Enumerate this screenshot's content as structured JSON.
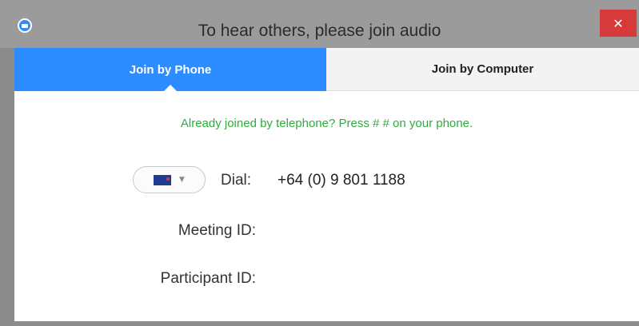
{
  "window": {
    "title": "To hear others, please join audio",
    "close_glyph": "✕"
  },
  "tabs": [
    {
      "label": "Join by Phone",
      "active": true
    },
    {
      "label": "Join by Computer",
      "active": false
    }
  ],
  "notice": "Already joined by telephone? Press #   # on your phone.",
  "dial": {
    "label": "Dial:",
    "number": "+64 (0) 9 801 1188",
    "country_selector": "nz-flag-icon"
  },
  "meeting_id": {
    "label": "Meeting ID:",
    "value": ""
  },
  "participant_id": {
    "label": "Participant ID:",
    "value": ""
  },
  "colors": {
    "accent": "#2d8cff",
    "notice": "#2eac3e",
    "close": "#d63a3a",
    "titlebar": "#9b9b9b"
  }
}
